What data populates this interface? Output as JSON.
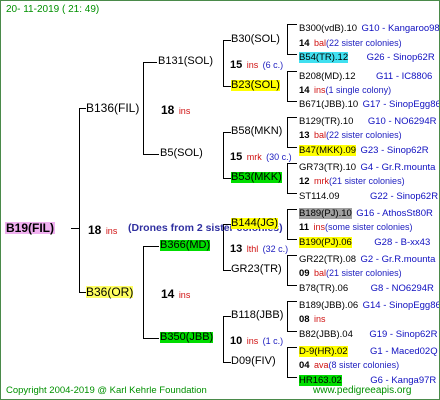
{
  "header": "20- 11-2019 ( 21: 49)",
  "footer": {
    "copyright": "Copyright 2004-2019 @ Karl Kehrle Foundation",
    "site": "www.pedigreeapis.org"
  },
  "root": {
    "name": "B19(FIL)",
    "gen": "18",
    "gen_suffix": "ins",
    "note": "(Drones from 2 sister colonies)"
  },
  "sire": {
    "name": "B136(FIL)",
    "gen": "18",
    "gen_suffix": "ins"
  },
  "dam": {
    "name": "B36(OR)",
    "gen": "14",
    "gen_suffix": "ins"
  },
  "gen3": [
    {
      "name": "B131(SOL)",
      "gen": "15",
      "gen_suffix": "ins",
      "gen_note": "(6 c.)"
    },
    {
      "name": "B5(SOL)",
      "gen": "15",
      "gen_suffix": "mrk",
      "gen_note": "(30 c.)"
    },
    {
      "name": "B366(MD)",
      "gen": "13",
      "gen_suffix": "lthl",
      "gen_note": "(32 c.)"
    },
    {
      "name": "B350(JBB)",
      "gen": "10",
      "gen_suffix": "ins",
      "gen_note": "(1 c.)"
    }
  ],
  "gen4": [
    {
      "name": "B30(SOL)"
    },
    {
      "name": "B23(SOL)",
      "highlight": "yellow"
    },
    {
      "name": "B58(MKN)"
    },
    {
      "name": "B53(MKK)",
      "highlight": "green"
    },
    {
      "name": "B144(JG)",
      "highlight": "yellow"
    },
    {
      "name": "GR23(TR)"
    },
    {
      "name": "B118(JBB)"
    },
    {
      "name": "D09(FIV)"
    }
  ],
  "gen5": [
    {
      "name": "B300(vdB).10",
      "code": "G10 - Kangaroo98R"
    },
    {
      "detail_gen": "14",
      "detail_suffix": "bal",
      "detail_note": "(22 sister colonies)"
    },
    {
      "name": "B54(TR).12",
      "code": "G26 - Sinop62R",
      "highlight": "cyan"
    },
    {
      "name": "B208(MD).12",
      "code": "G11 - IC8806"
    },
    {
      "detail_gen": "14",
      "detail_suffix": "ins",
      "detail_note": "(1 single colony)"
    },
    {
      "name": "B671(JBB).10",
      "code": "G17 - SinopEgg86R"
    },
    {
      "name": "B129(TR).10",
      "code": "G10 - NO6294R"
    },
    {
      "detail_gen": "13",
      "detail_suffix": "bal",
      "detail_note": "(22 sister colonies)"
    },
    {
      "name": "B47(MKK).09",
      "code": "G23 - Sinop62R",
      "highlight": "yellow"
    },
    {
      "name": "GR73(TR).10",
      "code": "G4 - Gr.R.mounta"
    },
    {
      "detail_gen": "12",
      "detail_suffix": "mrk",
      "detail_note": "(21 sister colonies)"
    },
    {
      "name": "ST114.09",
      "code": "G22 - Sinop62R"
    },
    {
      "name": "B189(PJ).10",
      "code": "G16 - AthosSt80R",
      "highlight": "gray"
    },
    {
      "detail_gen": "11",
      "detail_suffix": "ins",
      "detail_note": "(some sister colonies)"
    },
    {
      "name": "B190(PJ).06",
      "code": "G28 - B-xx43",
      "highlight": "yellow"
    },
    {
      "name": "GR22(TR).08",
      "code": "G2 - Gr.R.mounta"
    },
    {
      "detail_gen": "09",
      "detail_suffix": "bal",
      "detail_note": "(21 sister colonies)"
    },
    {
      "name": "B78(TR).06",
      "code": "G8 - NO6294R"
    },
    {
      "name": "B189(JBB).06",
      "code": "G14 - SinopEgg86R"
    },
    {
      "detail_gen": "08",
      "detail_suffix": "ins",
      "detail_note": ""
    },
    {
      "name": "B82(JBB).04",
      "code": "G19 - Sinop62R"
    },
    {
      "name": "D-9(HR).02",
      "code": "G1 - Maced02Q",
      "highlight": "yellow"
    },
    {
      "detail_gen": "04",
      "detail_suffix": "ava",
      "detail_note": "(8 sister colonies)"
    },
    {
      "name": "HR163.02",
      "code": "G6 - Kanga97R",
      "highlight": "green"
    }
  ]
}
